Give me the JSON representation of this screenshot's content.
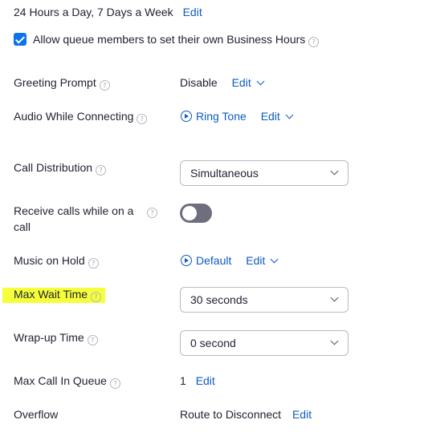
{
  "business_hours": {
    "text": "24 Hours a Day, 7 Days a Week",
    "edit_label": "Edit",
    "allow_own_hours_label": "Allow queue members to set their own Business Hours",
    "allow_own_hours_checked": true
  },
  "rows": {
    "greeting_prompt": {
      "label": "Greeting Prompt",
      "value": "Disable",
      "edit_label": "Edit"
    },
    "audio_while_connecting": {
      "label": "Audio While Connecting",
      "value": "Ring Tone",
      "edit_label": "Edit"
    },
    "call_distribution": {
      "label": "Call Distribution",
      "selected": "Simultaneous"
    },
    "receive_calls": {
      "label_line1": "Receive calls while on a",
      "label_line2": "call",
      "toggle_on": false
    },
    "music_on_hold": {
      "label": "Music on Hold",
      "value": "Default",
      "edit_label": "Edit"
    },
    "max_wait_time": {
      "label": "Max Wait Time",
      "selected": "30 seconds",
      "highlight_color": "#f5ff3a"
    },
    "wrap_up_time": {
      "label": "Wrap-up Time",
      "selected": "0 second"
    },
    "max_call_in_queue": {
      "label": "Max Call In Queue",
      "value": "1",
      "edit_label": "Edit"
    },
    "overflow": {
      "label": "Overflow",
      "value": "Route to Disconnect",
      "edit_label": "Edit"
    }
  },
  "help_icon_glyph": "?",
  "colors": {
    "link": "#0e5cbf",
    "text": "#232333",
    "checkbox": "#0e72ed",
    "toggle_off": "#6e6e7e"
  }
}
